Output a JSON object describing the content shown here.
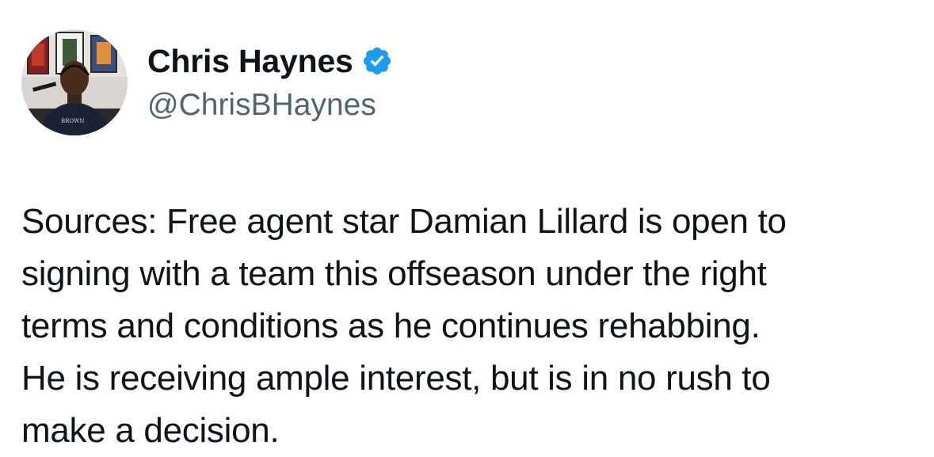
{
  "author": {
    "display_name": "Chris Haynes",
    "handle": "@ChrisBHaynes",
    "verified": true,
    "verified_icon": "verified-badge-icon",
    "verified_color": "#1d9bf0"
  },
  "tweet": {
    "lines": [
      "Sources: Free agent star Damian Lillard is open to",
      "signing with a team this offseason under the right",
      "terms and conditions as he continues rehabbing.",
      "He is receiving ample interest, but is in no rush to",
      "make a decision."
    ]
  },
  "colors": {
    "text_primary": "#0f1419",
    "text_secondary": "#536471",
    "background": "#ffffff"
  }
}
